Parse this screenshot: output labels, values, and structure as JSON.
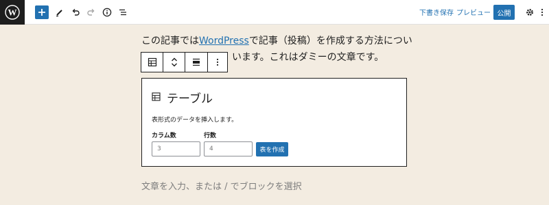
{
  "topbar": {
    "logo_icon": "wordpress-logo-icon",
    "tools": [
      "add-block-icon",
      "pencil-icon",
      "undo-icon",
      "redo-icon",
      "info-icon",
      "list-view-icon"
    ],
    "save_draft": "下書き保存",
    "preview": "プレビュー",
    "publish": "公開",
    "accent_color": "#2271b1"
  },
  "content": {
    "para_line1_before": "この記事では",
    "para_link": "WordPress",
    "para_line1_after": "で記事（投稿）を作成する方法につい",
    "para_line2": "います。これはダミーの文章です。"
  },
  "table_block": {
    "title": "テーブル",
    "description": "表形式のデータを挿入します。",
    "columns_label": "カラム数",
    "columns_value": "3",
    "rows_label": "行数",
    "rows_value": "4",
    "create_button": "表を作成"
  },
  "placeholder": "文章を入力、または / でブロックを選択"
}
